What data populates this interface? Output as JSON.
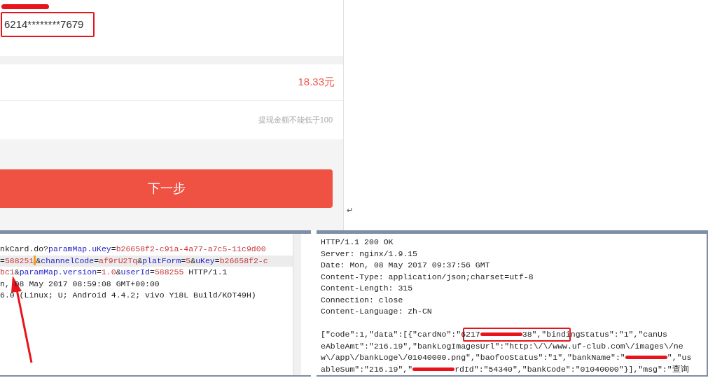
{
  "app": {
    "card_number": "6214********7679",
    "amount": "18.33元",
    "amount_field": {
      "placeholder": "提现金额不能低于100"
    },
    "next_button": "下一步"
  },
  "paragraph_mark": "↵",
  "request_pane": {
    "lines": [
      {
        "current": false,
        "segments": [
          {
            "kind": "plain",
            "text": "nkCard.do?"
          },
          {
            "kind": "key",
            "text": "paramMap.uKey"
          },
          {
            "kind": "plain",
            "text": "="
          },
          {
            "kind": "value",
            "text": "b26658f2-c91a-4a77-a7c5-11c9d00"
          }
        ]
      },
      {
        "current": true,
        "segments": [
          {
            "kind": "plain",
            "text": "="
          },
          {
            "kind": "value",
            "text": "588251"
          },
          {
            "kind": "cursor"
          },
          {
            "kind": "plain",
            "text": "&"
          },
          {
            "kind": "key",
            "text": "channelCode"
          },
          {
            "kind": "plain",
            "text": "="
          },
          {
            "kind": "value",
            "text": "af9rU2Tq"
          },
          {
            "kind": "plain",
            "text": "&"
          },
          {
            "kind": "key",
            "text": "platForm"
          },
          {
            "kind": "plain",
            "text": "="
          },
          {
            "kind": "value",
            "text": "5"
          },
          {
            "kind": "plain",
            "text": "&"
          },
          {
            "kind": "key",
            "text": "uKey"
          },
          {
            "kind": "plain",
            "text": "="
          },
          {
            "kind": "value",
            "text": "b26658f2-c"
          }
        ]
      },
      {
        "current": false,
        "segments": [
          {
            "kind": "value",
            "text": "bc1"
          },
          {
            "kind": "plain",
            "text": "&"
          },
          {
            "kind": "key",
            "text": "paramMap.version"
          },
          {
            "kind": "plain",
            "text": "="
          },
          {
            "kind": "value",
            "text": "1.0"
          },
          {
            "kind": "plain",
            "text": "&"
          },
          {
            "kind": "key",
            "text": "userId"
          },
          {
            "kind": "plain",
            "text": "="
          },
          {
            "kind": "value",
            "text": "588255"
          },
          {
            "kind": "plain",
            "text": " HTTP/1.1"
          }
        ]
      },
      {
        "current": false,
        "segments": [
          {
            "kind": "plain",
            "text": "n, 08 May 2017 08:59:08 GMT+00:00"
          }
        ]
      },
      {
        "current": false,
        "segments": [
          {
            "kind": "plain",
            "text": "6.0 (Linux; U; Android 4.4.2; vivo Y18L Build/KOT49H)"
          }
        ]
      }
    ]
  },
  "response_pane": {
    "lines": [
      {
        "segments": [
          {
            "kind": "plain",
            "text": "HTTP/1.1 200 OK"
          }
        ]
      },
      {
        "segments": [
          {
            "kind": "plain",
            "text": "Server: nginx/1.9.15"
          }
        ]
      },
      {
        "segments": [
          {
            "kind": "plain",
            "text": "Date: Mon, 08 May 2017 09:37:56 GMT"
          }
        ]
      },
      {
        "segments": [
          {
            "kind": "plain",
            "text": "Content-Type: application/json;charset=utf-8"
          }
        ]
      },
      {
        "segments": [
          {
            "kind": "plain",
            "text": "Content-Length: 315"
          }
        ]
      },
      {
        "segments": [
          {
            "kind": "plain",
            "text": "Connection: close"
          }
        ]
      },
      {
        "segments": [
          {
            "kind": "plain",
            "text": "Content-Language: zh-CN"
          }
        ]
      },
      {
        "spaced": true,
        "segments": [
          {
            "kind": "plain",
            "text": "[\"code\":1,\"data\":[{\"cardNo\":\"6217"
          },
          {
            "kind": "redacted"
          },
          {
            "kind": "plain",
            "text": "38\",\"bindingStatus\":\"1\",\"canUs"
          }
        ]
      },
      {
        "segments": [
          {
            "kind": "plain",
            "text": "eAbleAmt\":\"216.19\",\"bankLogImagesUrl\":\"http:\\/\\/www.uf-club.com\\/images\\/ne"
          }
        ]
      },
      {
        "segments": [
          {
            "kind": "plain",
            "text": "w\\/app\\/bankLoge\\/01040000.png\",\"baofooStatus\":\"1\",\"bankName\":\""
          },
          {
            "kind": "redacted"
          },
          {
            "kind": "plain",
            "text": "\",\"us"
          }
        ]
      },
      {
        "segments": [
          {
            "kind": "plain",
            "text": "ableSum\":\"216.19\",\""
          },
          {
            "kind": "redacted"
          },
          {
            "kind": "plain",
            "text": "rdId\":\"54340\",\"bankCode\":\"01040000\"}],\"msg\":\"查询"
          }
        ]
      }
    ]
  }
}
